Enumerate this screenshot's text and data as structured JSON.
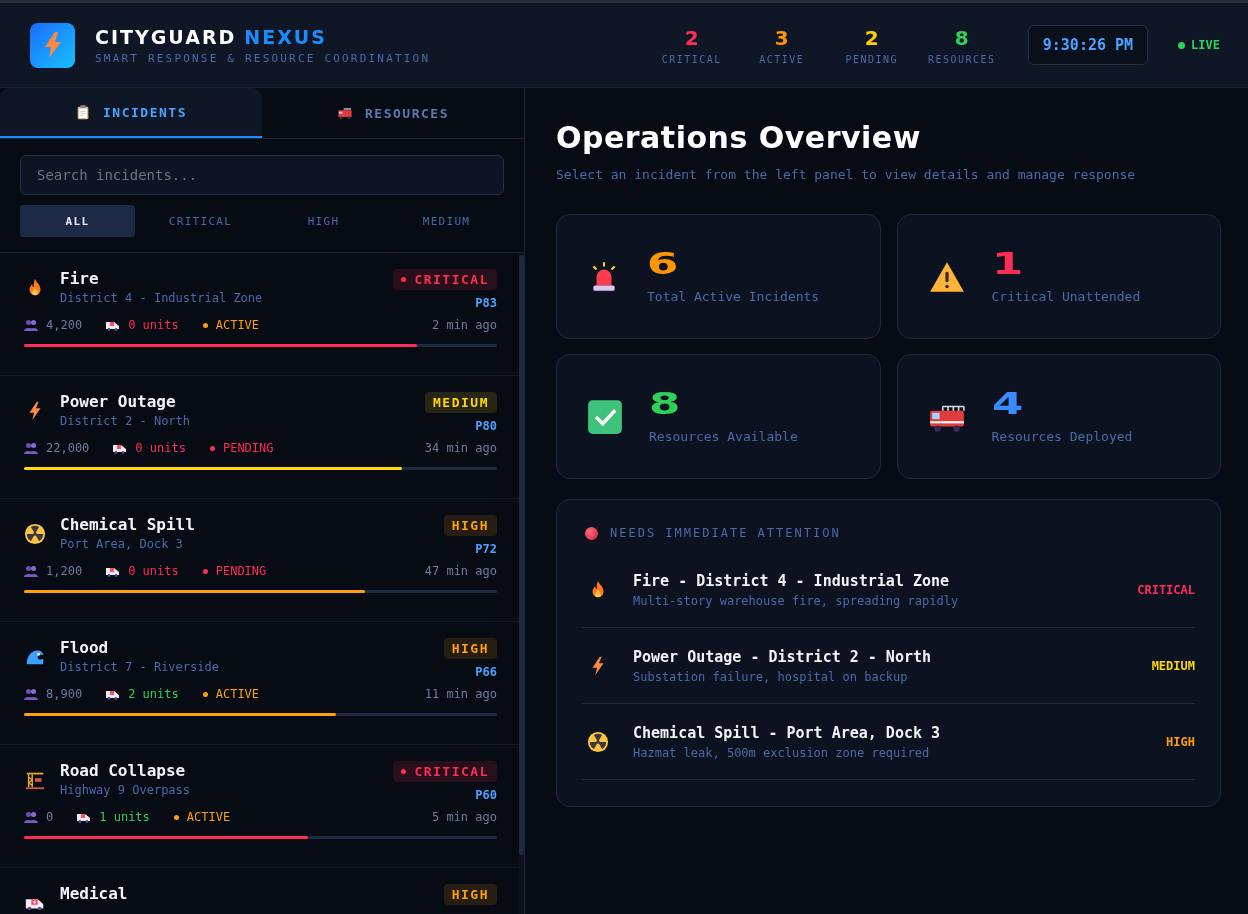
{
  "header": {
    "title": "CITYGUARD",
    "title_accent": "NEXUS",
    "subtitle": "SMART RESPONSE & RESOURCE COORDINATION",
    "stats": [
      {
        "value": "2",
        "label": "CRITICAL",
        "color": "#ff2d55"
      },
      {
        "value": "3",
        "label": "ACTIVE",
        "color": "#ff9500"
      },
      {
        "value": "2",
        "label": "PENDING",
        "color": "#ffcc00"
      },
      {
        "value": "8",
        "label": "RESOURCES",
        "color": "#30d158"
      }
    ],
    "clock": "9:30:26 PM",
    "live": "LIVE"
  },
  "tabs": [
    {
      "label": "INCIDENTS",
      "kind": "clipboard",
      "selected": true
    },
    {
      "label": "RESOURCES",
      "kind": "truck",
      "selected": false
    }
  ],
  "search": {
    "placeholder": "Search incidents..."
  },
  "filters": [
    {
      "label": "ALL",
      "selected": true
    },
    {
      "label": "CRITICAL",
      "selected": false
    },
    {
      "label": "HIGH",
      "selected": false
    },
    {
      "label": "MEDIUM",
      "selected": false
    }
  ],
  "incidents": [
    {
      "kind": "fire",
      "title": "Fire",
      "location": "District 4 - Industrial Zone",
      "severity": {
        "label": "CRITICAL",
        "color": "#ff2d55",
        "dot": true
      },
      "priority": "P83",
      "people": "4,200",
      "units": {
        "text": "0 units",
        "color": "#ff2d55"
      },
      "status": {
        "label": "ACTIVE",
        "color": "#ff9f0a"
      },
      "time": "2 min ago",
      "level": 0.83,
      "color": "#ff2d55"
    },
    {
      "kind": "power",
      "title": "Power Outage",
      "location": "District 2 - North",
      "severity": {
        "label": "MEDIUM",
        "color": "#ffd60a",
        "dot": false
      },
      "priority": "P80",
      "people": "22,000",
      "units": {
        "text": "0 units",
        "color": "#ff2d55"
      },
      "status": {
        "label": "PENDING",
        "color": "#ff2d55"
      },
      "time": "34 min ago",
      "level": 0.8,
      "color": "#ffd60a"
    },
    {
      "kind": "chemical",
      "title": "Chemical Spill",
      "location": "Port Area, Dock 3",
      "severity": {
        "label": "HIGH",
        "color": "#ff9f0a",
        "dot": false
      },
      "priority": "P72",
      "people": "1,200",
      "units": {
        "text": "0 units",
        "color": "#ff2d55"
      },
      "status": {
        "label": "PENDING",
        "color": "#ff2d55"
      },
      "time": "47 min ago",
      "level": 0.72,
      "color": "#ff9f0a"
    },
    {
      "kind": "flood",
      "title": "Flood",
      "location": "District 7 - Riverside",
      "severity": {
        "label": "HIGH",
        "color": "#ff9f0a",
        "dot": false
      },
      "priority": "P66",
      "people": "8,900",
      "units": {
        "text": "2 units",
        "color": "#30d158"
      },
      "status": {
        "label": "ACTIVE",
        "color": "#ff9f0a"
      },
      "time": "11 min ago",
      "level": 0.66,
      "color": "#ff9f0a"
    },
    {
      "kind": "collapse",
      "title": "Road Collapse",
      "location": "Highway 9 Overpass",
      "severity": {
        "label": "CRITICAL",
        "color": "#ff2d55",
        "dot": true
      },
      "priority": "P60",
      "people": "0",
      "units": {
        "text": "1 units",
        "color": "#30d158"
      },
      "status": {
        "label": "ACTIVE",
        "color": "#ff9f0a"
      },
      "time": "5 min ago",
      "level": 0.6,
      "color": "#ff2d55"
    },
    {
      "kind": "medical",
      "title": "Medical",
      "severity": {
        "label": "HIGH",
        "color": "#ff9f0a",
        "dot": false
      }
    }
  ],
  "overview": {
    "title": "Operations Overview",
    "subtitle": "Select an incident from the left panel to view details and manage response",
    "cards": [
      {
        "kind": "siren",
        "value": "6",
        "label": "Total Active Incidents",
        "color": "#ff9500"
      },
      {
        "kind": "warning",
        "value": "1",
        "label": "Critical Unattended",
        "color": "#ff2d55"
      },
      {
        "kind": "check",
        "value": "8",
        "label": "Resources Available",
        "color": "#30d158"
      },
      {
        "kind": "firetruck",
        "value": "4",
        "label": "Resources Deployed",
        "color": "#3b8cff"
      }
    ],
    "attention": {
      "title": "NEEDS IMMEDIATE ATTENTION",
      "items": [
        {
          "kind": "fire",
          "title": "Fire - District 4 - Industrial Zone",
          "detail": "Multi-story warehouse fire, spreading rapidly",
          "severity": "CRITICAL",
          "color": "#ff2d55"
        },
        {
          "kind": "power",
          "title": "Power Outage - District 2 - North",
          "detail": "Substation failure, hospital on backup",
          "severity": "MEDIUM",
          "color": "#ffd60a"
        },
        {
          "kind": "chemical",
          "title": "Chemical Spill - Port Area, Dock 3",
          "detail": "Hazmat leak, 500m exclusion zone required",
          "severity": "HIGH",
          "color": "#ff9f0a"
        }
      ]
    }
  }
}
